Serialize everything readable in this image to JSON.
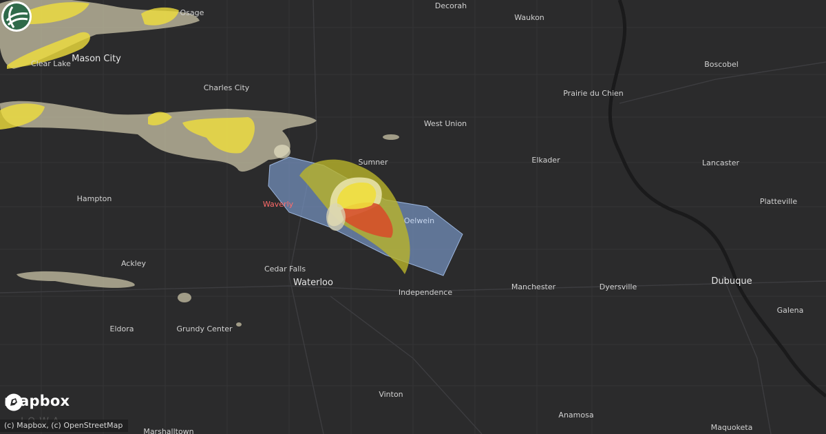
{
  "map": {
    "cities": [
      {
        "name": "Osage"
      },
      {
        "name": "Decorah"
      },
      {
        "name": "Waukon"
      },
      {
        "name": "Mason City"
      },
      {
        "name": "Clear Lake"
      },
      {
        "name": "Charles City"
      },
      {
        "name": "Boscobel"
      },
      {
        "name": "Prairie du Chien"
      },
      {
        "name": "West Union"
      },
      {
        "name": "Sumner"
      },
      {
        "name": "Elkader"
      },
      {
        "name": "Lancaster"
      },
      {
        "name": "Hampton"
      },
      {
        "name": "Waverly"
      },
      {
        "name": "Oelwein"
      },
      {
        "name": "Platteville"
      },
      {
        "name": "Ackley"
      },
      {
        "name": "Cedar Falls"
      },
      {
        "name": "Waterloo"
      },
      {
        "name": "Dubuque"
      },
      {
        "name": "Manchester"
      },
      {
        "name": "Dyersville"
      },
      {
        "name": "Independence"
      },
      {
        "name": "Galena"
      },
      {
        "name": "Eldora"
      },
      {
        "name": "Grundy Center"
      },
      {
        "name": "Vinton"
      },
      {
        "name": "Anamosa"
      },
      {
        "name": "Maquoketa"
      },
      {
        "name": "Marshalltown"
      }
    ],
    "state_label": "IOWA",
    "colors": {
      "background": "#2b2b2c",
      "river": "#1a1a1b",
      "hail_tan": "#c9c3a6",
      "hail_light_yellow": "#e9e3a8",
      "hail_yellow": "#f0de3c",
      "hail_olive": "#b9b42b",
      "hail_orange": "#e0a030",
      "hail_red": "#d6502a",
      "warning_blue": "#7c9dcf"
    }
  },
  "branding": {
    "logo_text": "mapbox",
    "attribution": "(c) Mapbox, (c) OpenStreetMap",
    "badge_icon": "globe-icon"
  }
}
